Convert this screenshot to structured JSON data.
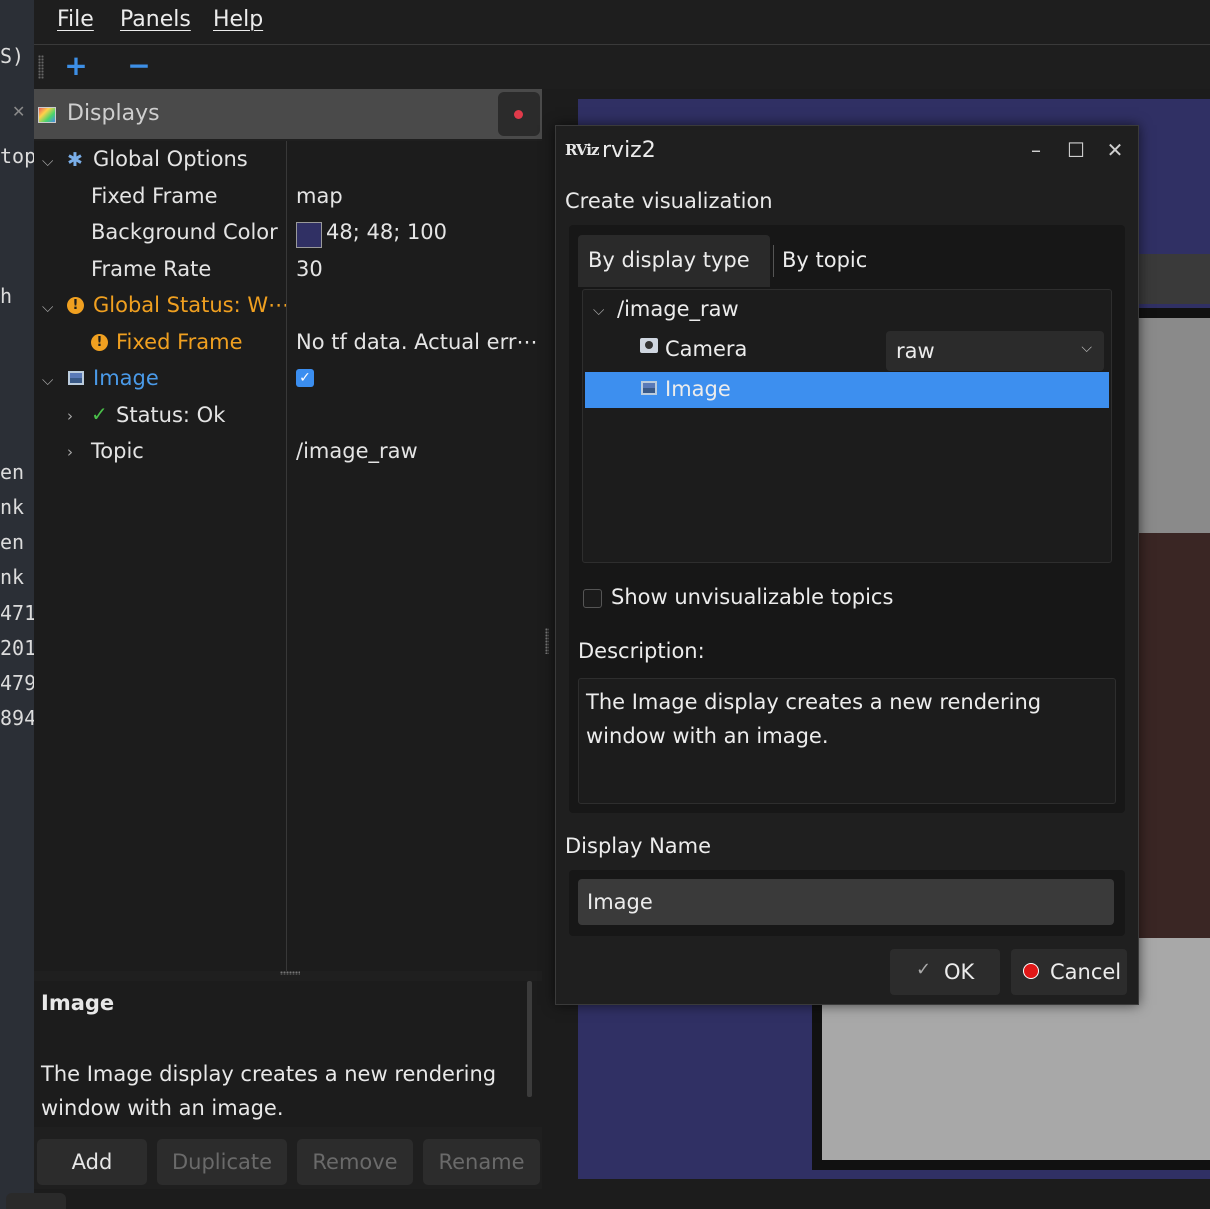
{
  "left_strip": {
    "fragments": [
      "S)",
      "top",
      "h",
      "en",
      "nk",
      "en",
      "nk",
      "471",
      "201",
      "479",
      "894"
    ]
  },
  "menu": {
    "file": "File",
    "panels": "Panels",
    "help": "Help"
  },
  "toolbar": {
    "add_symbol": "+",
    "remove_symbol": "−"
  },
  "displays": {
    "title": "Displays",
    "rows": {
      "global_options": "Global Options",
      "fixed_frame": {
        "label": "Fixed Frame",
        "value": "map"
      },
      "background_color": {
        "label": "Background Color",
        "value": "48; 48; 100",
        "swatch": "#303064"
      },
      "frame_rate": {
        "label": "Frame Rate",
        "value": "30"
      },
      "global_status": "Global Status: W⋯",
      "fixed_frame_status": {
        "label": "Fixed Frame",
        "value": "No tf data.  Actual err⋯"
      },
      "image": {
        "label": "Image",
        "enabled": true
      },
      "status_ok": "Status: Ok",
      "topic": {
        "label": "Topic",
        "value": "/image_raw"
      }
    },
    "description": {
      "title": "Image",
      "text": "The Image display creates a new rendering window with an image."
    },
    "buttons": {
      "add": "Add",
      "duplicate": "Duplicate",
      "remove": "Remove",
      "rename": "Rename"
    }
  },
  "dialog": {
    "logo": "RViz",
    "title": "rviz2",
    "heading": "Create visualization",
    "tabs": {
      "by_display_type": "By display type",
      "by_topic": "By topic"
    },
    "tree": {
      "topic": "/image_raw",
      "camera": "Camera",
      "camera_transport": "raw",
      "image": "Image"
    },
    "show_unvisualizable": {
      "label": "Show unvisualizable topics",
      "checked": false
    },
    "description_label": "Description:",
    "description_text": "The Image display creates a new rendering window with an image.",
    "display_name_label": "Display Name",
    "display_name_value": "Image",
    "ok": "OK",
    "cancel": "Cancel"
  },
  "colors": {
    "accent": "#3d8fef",
    "warning": "#f0a020",
    "viewport_background": "#303064"
  }
}
